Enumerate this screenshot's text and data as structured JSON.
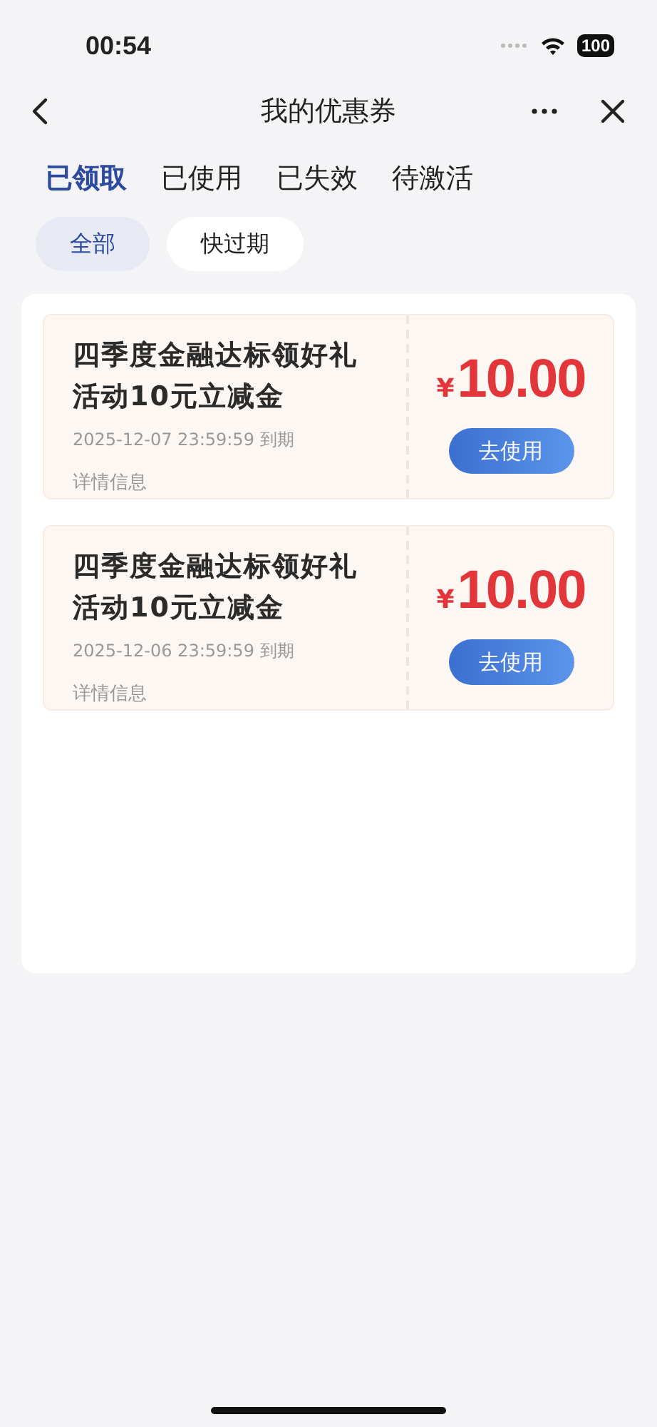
{
  "status_bar": {
    "time": "00:54",
    "battery": "100"
  },
  "nav": {
    "title": "我的优惠券"
  },
  "tabs": [
    {
      "label": "已领取",
      "selected": true
    },
    {
      "label": "已使用",
      "selected": false
    },
    {
      "label": "已失效",
      "selected": false
    },
    {
      "label": "待激活",
      "selected": false
    }
  ],
  "filters": [
    {
      "label": "全部",
      "selected": true
    },
    {
      "label": "快过期",
      "selected": false
    }
  ],
  "coupons": [
    {
      "title": "四季度金融达标领好礼活动10元立减金",
      "expiry": "2025-12-07 23:59:59 到期",
      "details": "详情信息",
      "currency": "¥",
      "amount": "10.00",
      "button": "去使用"
    },
    {
      "title": "四季度金融达标领好礼活动10元立减金",
      "expiry": "2025-12-06 23:59:59 到期",
      "details": "详情信息",
      "currency": "¥",
      "amount": "10.00",
      "button": "去使用"
    }
  ]
}
